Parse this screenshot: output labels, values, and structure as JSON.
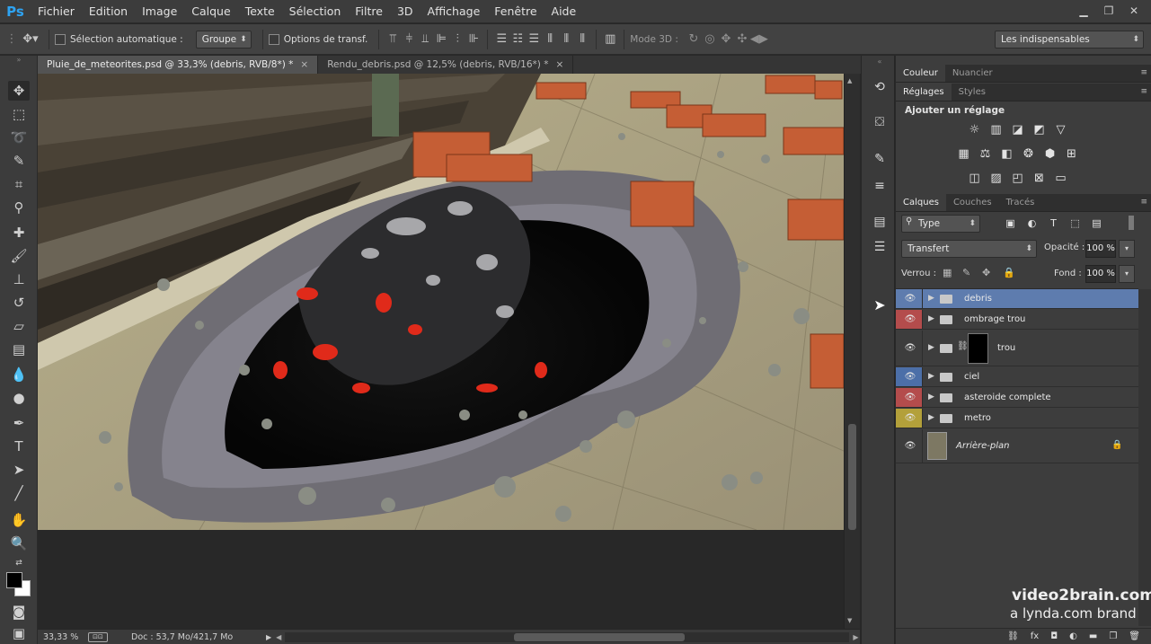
{
  "app": {
    "logo": "Ps"
  },
  "menu": [
    "Fichier",
    "Edition",
    "Image",
    "Calque",
    "Texte",
    "Sélection",
    "Filtre",
    "3D",
    "Affichage",
    "Fenêtre",
    "Aide"
  ],
  "options_bar": {
    "auto_select_label": "Sélection automatique :",
    "auto_select_mode": "Groupe",
    "transform_label": "Options de transf.",
    "mode3d_label": "Mode 3D :",
    "workspace": "Les indispensables"
  },
  "tabs": [
    {
      "label": "Pluie_de_meteorites.psd @ 33,3% (debris, RVB/8*) *",
      "close": "×"
    },
    {
      "label": "Rendu_debris.psd @ 12,5% (debris, RVB/16*) *",
      "close": "×"
    }
  ],
  "status": {
    "zoom": "33,33 %",
    "doc": "Doc : 53,7 Mo/421,7 Mo"
  },
  "panels": {
    "color_tabs": [
      "Couleur",
      "Nuancier"
    ],
    "adjust_tabs": [
      "Réglages",
      "Styles"
    ],
    "adjust_title": "Ajouter un réglage",
    "layers_tabs": [
      "Calques",
      "Couches",
      "Tracés"
    ]
  },
  "layers_panel": {
    "filter": "Type",
    "blend_mode": "Transfert",
    "opacity_label": "Opacité :",
    "opacity": "100 %",
    "lock_label": "Verrou :",
    "fill_label": "Fond :",
    "fill": "100 %",
    "layers": [
      {
        "name": "debris",
        "tag_color": "",
        "selected": true
      },
      {
        "name": "ombrage trou",
        "tag_color": "#b44c4c"
      },
      {
        "name": "trou",
        "tag_color": ""
      },
      {
        "name": "ciel",
        "tag_color": "#4c6fa8"
      },
      {
        "name": "asteroide complete",
        "tag_color": "#b44c4c"
      },
      {
        "name": "metro",
        "tag_color": "#b3a03a"
      },
      {
        "name": "Arrière-plan",
        "tag_color": "",
        "locked": true
      }
    ]
  },
  "watermark": {
    "line1": "video2brain.com",
    "line2": "a lynda.com brand"
  }
}
